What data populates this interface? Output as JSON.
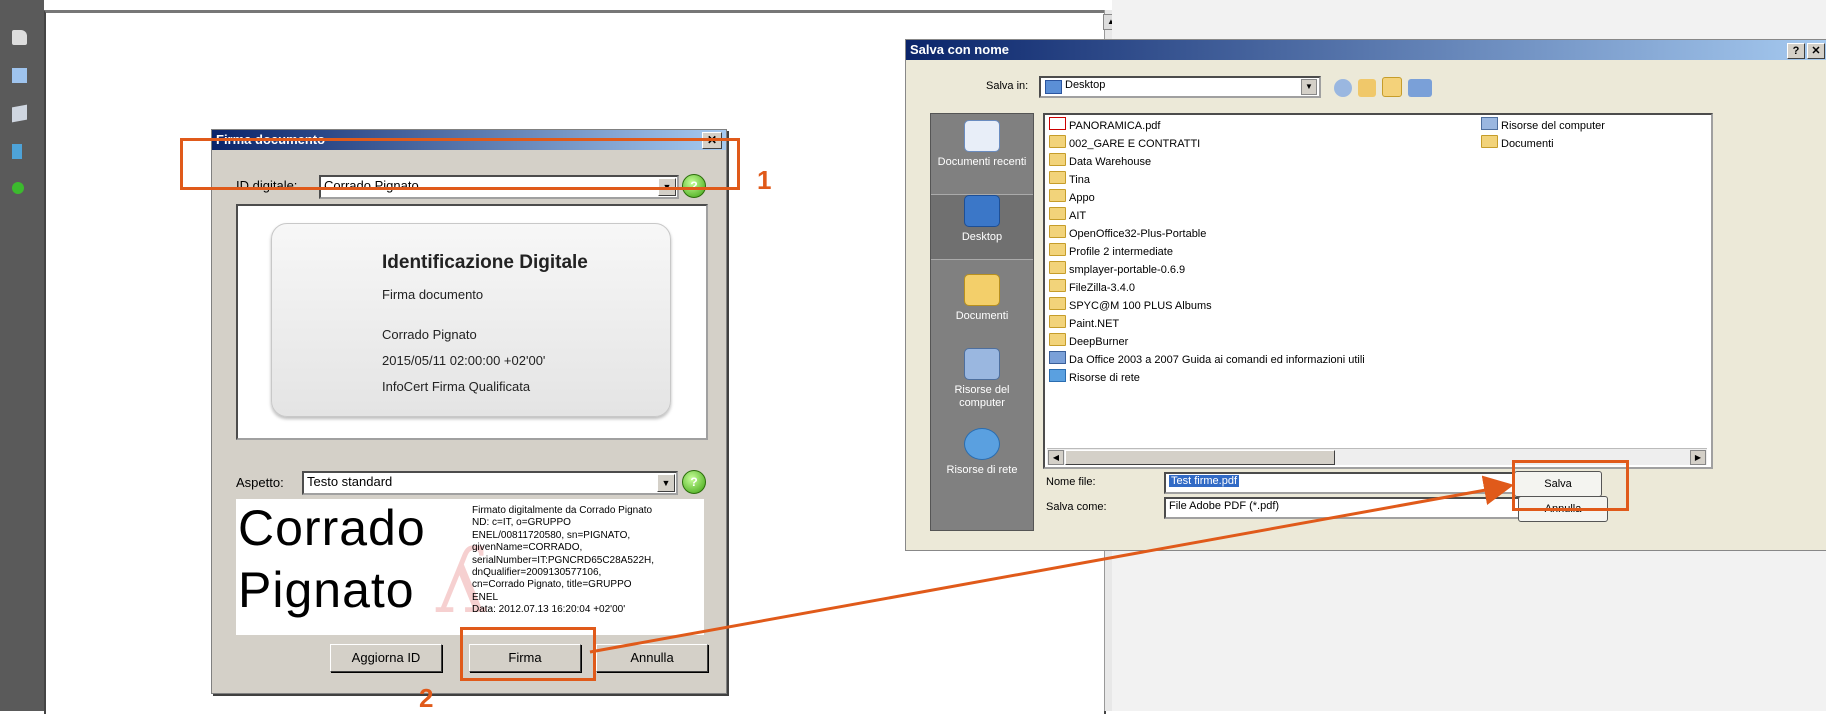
{
  "reader": {
    "toolbar_icons": [
      "page-icon",
      "document-icon",
      "layers-icon",
      "tree-icon",
      "signature-icon"
    ],
    "scroll_up_arrow": "▲"
  },
  "firma_dialog": {
    "title": "Firma documento",
    "close_label": "✕",
    "id_label": "ID digitale:",
    "id_value": "Corrado Pignato",
    "help_label": "?",
    "card": {
      "title": "Identificazione Digitale",
      "subtitle": "Firma documento",
      "name": "Corrado Pignato",
      "datetime": "2015/05/11 02:00:00 +02'00'",
      "provider": "InfoCert Firma Qualificata"
    },
    "aspetto_label": "Aspetto:",
    "aspetto_value": "Testo standard",
    "signature": {
      "name_line1": "Corrado",
      "name_line2": "Pignato",
      "details": [
        "Firmato digitalmente da Corrado Pignato",
        "ND: c=IT, o=GRUPPO",
        "ENEL/00811720580, sn=PIGNATO,",
        "givenName=CORRADO,",
        "serialNumber=IT:PGNCRD65C28A522H,",
        "dnQualifier=2009130577106,",
        "cn=Corrado Pignato, title=GRUPPO",
        "ENEL",
        "Data: 2012.07.13 16:20:04 +02'00'"
      ]
    },
    "buttons": {
      "aggiorna": "Aggiorna ID",
      "firma": "Firma",
      "annulla": "Annulla"
    }
  },
  "save_dialog": {
    "title": "Salva con nome",
    "title_buttons": [
      "?",
      "✕"
    ],
    "salva_in_label": "Salva in:",
    "salva_in_value": "Desktop",
    "places": [
      "Documenti recenti",
      "Desktop",
      "Documenti",
      "Risorse del computer",
      "Risorse di rete"
    ],
    "files_col1": [
      "PANORAMICA.pdf",
      "002_GARE E CONTRATTI",
      "Data Warehouse",
      "Tina",
      "Appo",
      "AIT",
      "OpenOffice32-Plus-Portable",
      "Profile 2 intermediate",
      "smplayer-portable-0.6.9",
      "FileZilla-3.4.0",
      "SPYC@M 100 PLUS Albums",
      "Paint.NET",
      "DeepBurner",
      "Da Office 2003 a 2007 Guida ai comandi ed informazioni utili",
      "Risorse di rete"
    ],
    "files_col2": [
      "Risorse del computer",
      "Documenti"
    ],
    "nome_file_label": "Nome file:",
    "nome_file_value": "Test firme.pdf",
    "salva_come_label": "Salva come:",
    "salva_come_value": "File Adobe PDF (*.pdf)",
    "buttons": {
      "salva": "Salva",
      "annulla": "Annulla"
    }
  },
  "annotations": {
    "step1": "1",
    "step2": "2",
    "color": "#e05a1a"
  }
}
